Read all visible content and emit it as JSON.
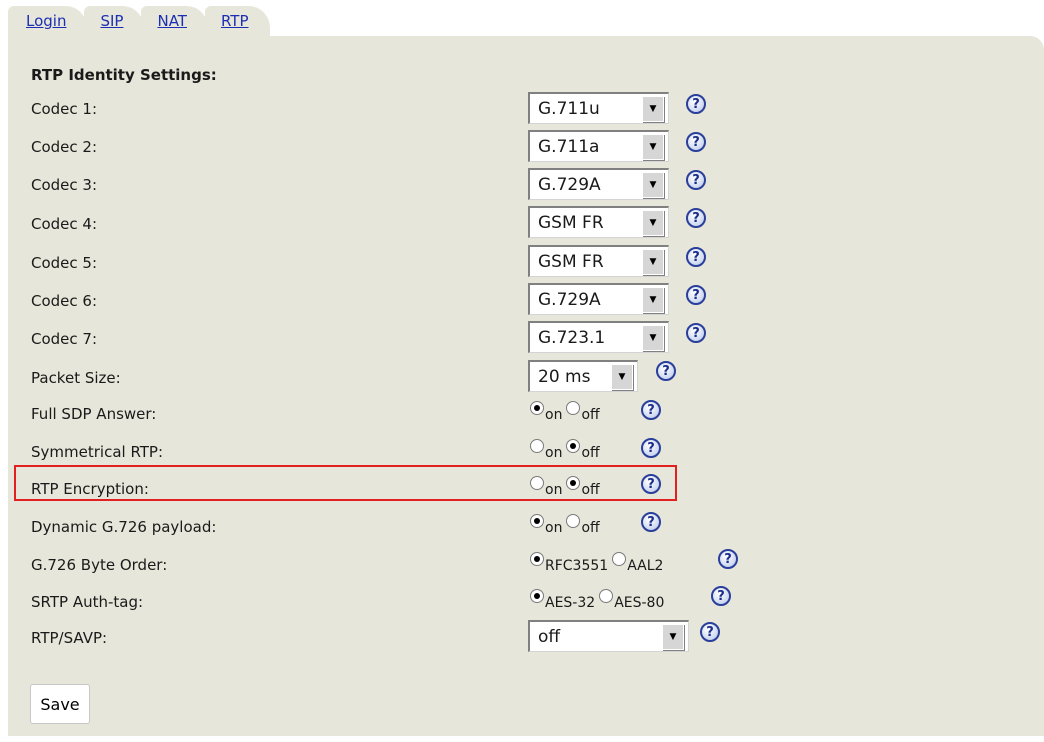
{
  "tabs": [
    "Login",
    "SIP",
    "NAT",
    "RTP"
  ],
  "section_title": "RTP Identity Settings:",
  "help_glyph": "?",
  "dropdown_arrow": "▼",
  "rows": {
    "codec1": {
      "label": "Codec 1:",
      "value": "G.711u"
    },
    "codec2": {
      "label": "Codec 2:",
      "value": "G.711a"
    },
    "codec3": {
      "label": "Codec 3:",
      "value": "G.729A"
    },
    "codec4": {
      "label": "Codec 4:",
      "value": "GSM FR"
    },
    "codec5": {
      "label": "Codec 5:",
      "value": "GSM FR"
    },
    "codec6": {
      "label": "Codec 6:",
      "value": "G.729A"
    },
    "codec7": {
      "label": "Codec 7:",
      "value": "G.723.1"
    },
    "packet_size": {
      "label": "Packet Size:",
      "value": "20 ms"
    },
    "full_sdp": {
      "label": "Full SDP Answer:",
      "opt1": "on",
      "opt2": "off",
      "selected": "on"
    },
    "symmetrical_rtp": {
      "label": "Symmetrical RTP:",
      "opt1": "on",
      "opt2": "off",
      "selected": "off"
    },
    "rtp_encryption": {
      "label": "RTP Encryption:",
      "opt1": "on",
      "opt2": "off",
      "selected": "off"
    },
    "dynamic_g726": {
      "label": "Dynamic G.726 payload:",
      "opt1": "on",
      "opt2": "off",
      "selected": "on"
    },
    "g726_byte_order": {
      "label": "G.726 Byte Order:",
      "opt1": "RFC3551",
      "opt2": "AAL2",
      "selected": "RFC3551"
    },
    "srtp_auth_tag": {
      "label": "SRTP Auth-tag:",
      "opt1": "AES-32",
      "opt2": "AES-80",
      "selected": "AES-32"
    },
    "rtp_savp": {
      "label": "RTP/SAVP:",
      "value": "off"
    }
  },
  "save_label": "Save",
  "colors": {
    "panel_bg": "#e6e6da",
    "tab_link": "#1c2fb3",
    "highlight_border": "#e32020"
  }
}
